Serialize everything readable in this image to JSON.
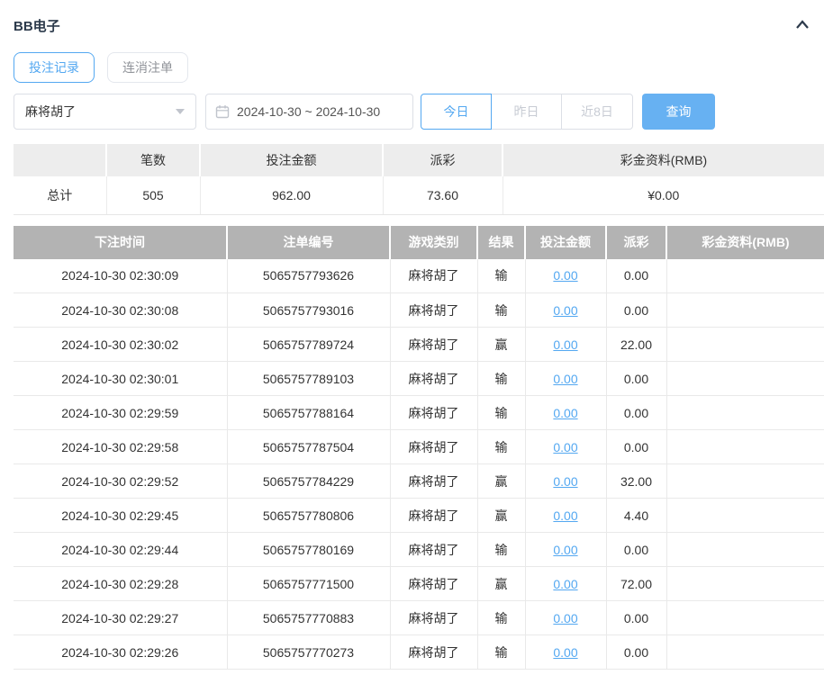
{
  "header": {
    "title": "BB电子"
  },
  "tabs": [
    {
      "label": "投注记录",
      "active": true
    },
    {
      "label": "连消注单",
      "active": false
    }
  ],
  "filters": {
    "game_select": {
      "value": "麻将胡了"
    },
    "date_range": {
      "value": "2024-10-30 ~ 2024-10-30"
    },
    "quick_buttons": [
      {
        "label": "今日",
        "active": true
      },
      {
        "label": "昨日",
        "active": false
      },
      {
        "label": "近8日",
        "active": false
      }
    ],
    "search_label": "查询"
  },
  "colors": {
    "accent_blue": "#54a8f1",
    "search_button_blue": "#67b1f2",
    "records_header_gray": "#b3b3b3",
    "summary_header_gray": "#ededed"
  },
  "summary_table": {
    "headers": [
      "",
      "笔数",
      "投注金额",
      "派彩",
      "彩金资料(RMB)"
    ],
    "row": {
      "label": "总计",
      "count": "505",
      "bet_amount": "962.00",
      "payout": "73.60",
      "jackpot": "¥0.00"
    }
  },
  "records_table": {
    "headers": [
      "下注时间",
      "注单编号",
      "游戏类别",
      "结果",
      "投注金额",
      "派彩",
      "彩金资料(RMB)"
    ],
    "rows": [
      {
        "time": "2024-10-30 02:30:09",
        "order_no": "5065757793626",
        "game": "麻将胡了",
        "result": "输",
        "bet": "0.00",
        "payout": "0.00",
        "jackpot": ""
      },
      {
        "time": "2024-10-30 02:30:08",
        "order_no": "5065757793016",
        "game": "麻将胡了",
        "result": "输",
        "bet": "0.00",
        "payout": "0.00",
        "jackpot": ""
      },
      {
        "time": "2024-10-30 02:30:02",
        "order_no": "5065757789724",
        "game": "麻将胡了",
        "result": "赢",
        "bet": "0.00",
        "payout": "22.00",
        "jackpot": ""
      },
      {
        "time": "2024-10-30 02:30:01",
        "order_no": "5065757789103",
        "game": "麻将胡了",
        "result": "输",
        "bet": "0.00",
        "payout": "0.00",
        "jackpot": ""
      },
      {
        "time": "2024-10-30 02:29:59",
        "order_no": "5065757788164",
        "game": "麻将胡了",
        "result": "输",
        "bet": "0.00",
        "payout": "0.00",
        "jackpot": ""
      },
      {
        "time": "2024-10-30 02:29:58",
        "order_no": "5065757787504",
        "game": "麻将胡了",
        "result": "输",
        "bet": "0.00",
        "payout": "0.00",
        "jackpot": ""
      },
      {
        "time": "2024-10-30 02:29:52",
        "order_no": "5065757784229",
        "game": "麻将胡了",
        "result": "赢",
        "bet": "0.00",
        "payout": "32.00",
        "jackpot": ""
      },
      {
        "time": "2024-10-30 02:29:45",
        "order_no": "5065757780806",
        "game": "麻将胡了",
        "result": "赢",
        "bet": "0.00",
        "payout": "4.40",
        "jackpot": ""
      },
      {
        "time": "2024-10-30 02:29:44",
        "order_no": "5065757780169",
        "game": "麻将胡了",
        "result": "输",
        "bet": "0.00",
        "payout": "0.00",
        "jackpot": ""
      },
      {
        "time": "2024-10-30 02:29:28",
        "order_no": "5065757771500",
        "game": "麻将胡了",
        "result": "赢",
        "bet": "0.00",
        "payout": "72.00",
        "jackpot": ""
      },
      {
        "time": "2024-10-30 02:29:27",
        "order_no": "5065757770883",
        "game": "麻将胡了",
        "result": "输",
        "bet": "0.00",
        "payout": "0.00",
        "jackpot": ""
      },
      {
        "time": "2024-10-30 02:29:26",
        "order_no": "5065757770273",
        "game": "麻将胡了",
        "result": "输",
        "bet": "0.00",
        "payout": "0.00",
        "jackpot": ""
      }
    ]
  }
}
